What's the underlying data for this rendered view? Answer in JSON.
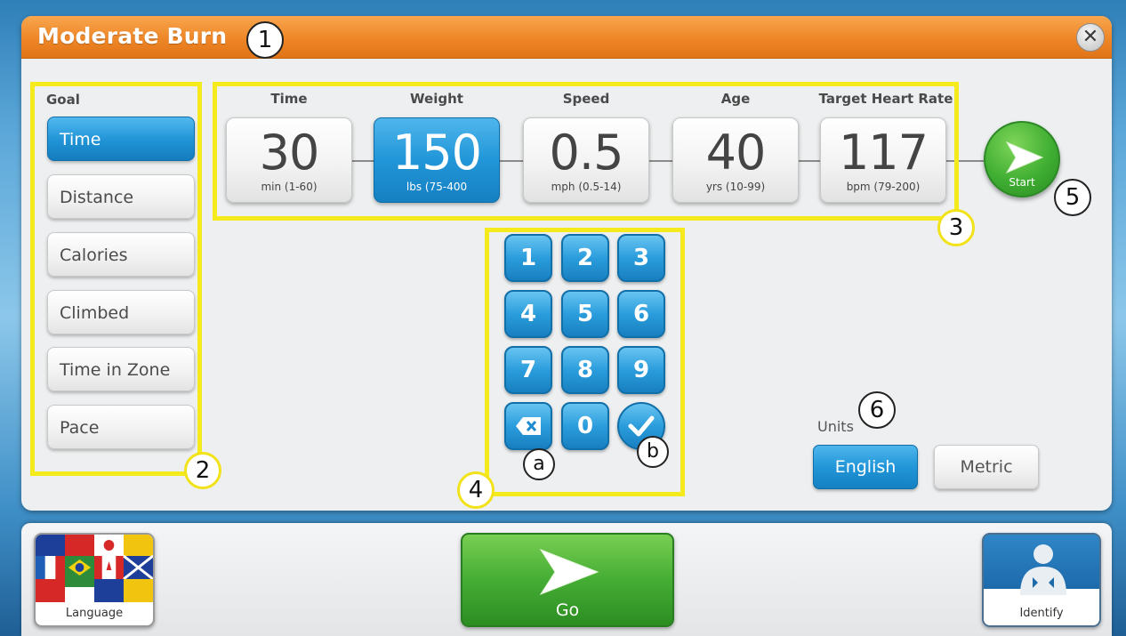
{
  "window": {
    "title": "Moderate Burn",
    "close_symbol": "✕"
  },
  "goal": {
    "label": "Goal",
    "options": [
      {
        "label": "Time",
        "active": true
      },
      {
        "label": "Distance",
        "active": false
      },
      {
        "label": "Calories",
        "active": false
      },
      {
        "label": "Climbed",
        "active": false
      },
      {
        "label": "Time in Zone",
        "active": false
      },
      {
        "label": "Pace",
        "active": false
      }
    ]
  },
  "params": [
    {
      "label": "Time",
      "value": "30",
      "range": "min (1-60)",
      "active": false
    },
    {
      "label": "Weight",
      "value": "150",
      "range": "lbs (75-400",
      "active": true
    },
    {
      "label": "Speed",
      "value": "0.5",
      "range": "mph (0.5-14)",
      "active": false
    },
    {
      "label": "Age",
      "value": "40",
      "range": "yrs (10-99)",
      "active": false
    },
    {
      "label": "Target Heart Rate",
      "value": "117",
      "range": "bpm (79-200)",
      "active": false
    }
  ],
  "start": {
    "label": "Start",
    "icon": "arrow-right-icon"
  },
  "keypad": {
    "keys": [
      "1",
      "2",
      "3",
      "4",
      "5",
      "6",
      "7",
      "8",
      "9"
    ],
    "zero": "0",
    "backspace_icon": "backspace-icon",
    "confirm_icon": "checkmark-icon"
  },
  "units": {
    "label": "Units",
    "options": [
      {
        "label": "English",
        "active": true
      },
      {
        "label": "Metric",
        "active": false
      }
    ]
  },
  "bottom": {
    "language_label": "Language",
    "go_label": "Go",
    "identify_label": "Identify"
  },
  "callouts": {
    "c1": "1",
    "c2": "2",
    "c3": "3",
    "c4": "4",
    "c5": "5",
    "c6": "6",
    "ca": "a",
    "cb": "b"
  },
  "colors": {
    "title_orange": "#ee8627",
    "highlight_yellow": "#f4ea1c",
    "active_blue": "#2196d8",
    "go_green": "#45ad34"
  }
}
